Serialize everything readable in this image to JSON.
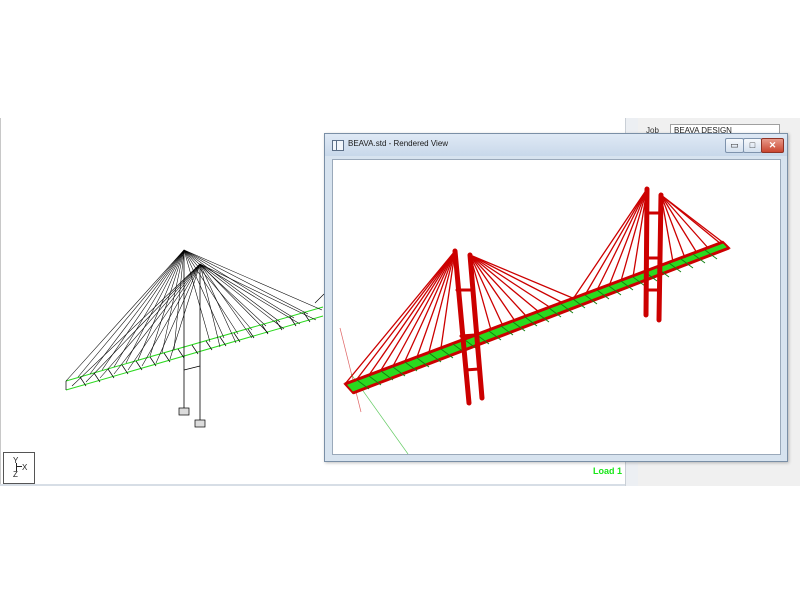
{
  "main_view": {
    "axis_triad": {
      "y": "Y",
      "x": "X",
      "z": "Z"
    },
    "load_label": "Load 1"
  },
  "side_panel": {
    "label": "Job",
    "value": "BEAVA DESIGN"
  },
  "rendered_window": {
    "title": "BEAVA.std - Rendered View",
    "controls": {
      "minimize": "▭",
      "maximize": "□",
      "close": "✕"
    }
  },
  "colors": {
    "deck_green": "#2bd91f",
    "structure_red": "#cc0000",
    "wire_black": "#000000",
    "load_green": "#19e619"
  }
}
